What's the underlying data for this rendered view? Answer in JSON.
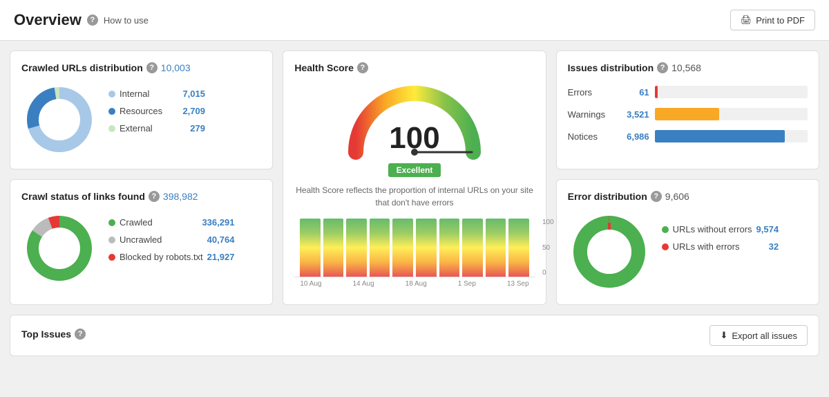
{
  "header": {
    "title": "Overview",
    "how_to_use": "How to use",
    "print_btn": "Print to PDF"
  },
  "crawled_urls": {
    "title": "Crawled URLs distribution",
    "total": "10,003",
    "legend": [
      {
        "label": "Internal",
        "value": "7,015",
        "color": "#a8c8e8"
      },
      {
        "label": "Resources",
        "value": "2,709",
        "color": "#3a7fc1"
      },
      {
        "label": "External",
        "value": "279",
        "color": "#c8e6c0"
      }
    ]
  },
  "health_score": {
    "title": "Health Score",
    "score": "100",
    "badge": "Excellent",
    "description": "Health Score reflects the proportion of internal URLs on your site that don't have errors",
    "bar_labels": [
      "10 Aug",
      "14 Aug",
      "18 Aug",
      "1 Sep",
      "13 Sep"
    ],
    "y_labels": [
      "100",
      "50",
      "0"
    ]
  },
  "issues_dist": {
    "title": "Issues distribution",
    "total": "10,568",
    "rows": [
      {
        "label": "Errors",
        "value": "61",
        "color": "#e53935",
        "pct": 2
      },
      {
        "label": "Warnings",
        "value": "3,521",
        "color": "#f9a825",
        "pct": 42
      },
      {
        "label": "Notices",
        "value": "6,986",
        "color": "#3a7fc1",
        "pct": 85
      }
    ]
  },
  "crawl_status": {
    "title": "Crawl status of links found",
    "total": "398,982",
    "legend": [
      {
        "label": "Crawled",
        "value": "336,291",
        "color": "#4caf50"
      },
      {
        "label": "Uncrawled",
        "value": "40,764",
        "color": "#bbb"
      },
      {
        "label": "Blocked by robots.txt",
        "value": "21,927",
        "color": "#e53935"
      }
    ]
  },
  "error_dist": {
    "title": "Error distribution",
    "total": "9,606",
    "legend": [
      {
        "label": "URLs without errors",
        "value": "9,574",
        "color": "#4caf50"
      },
      {
        "label": "URLs with errors",
        "value": "32",
        "color": "#e53935"
      }
    ]
  },
  "top_issues": {
    "title": "Top Issues",
    "export_btn": "Export all issues"
  },
  "icons": {
    "help": "?",
    "print": "🖨",
    "download": "⬇"
  }
}
